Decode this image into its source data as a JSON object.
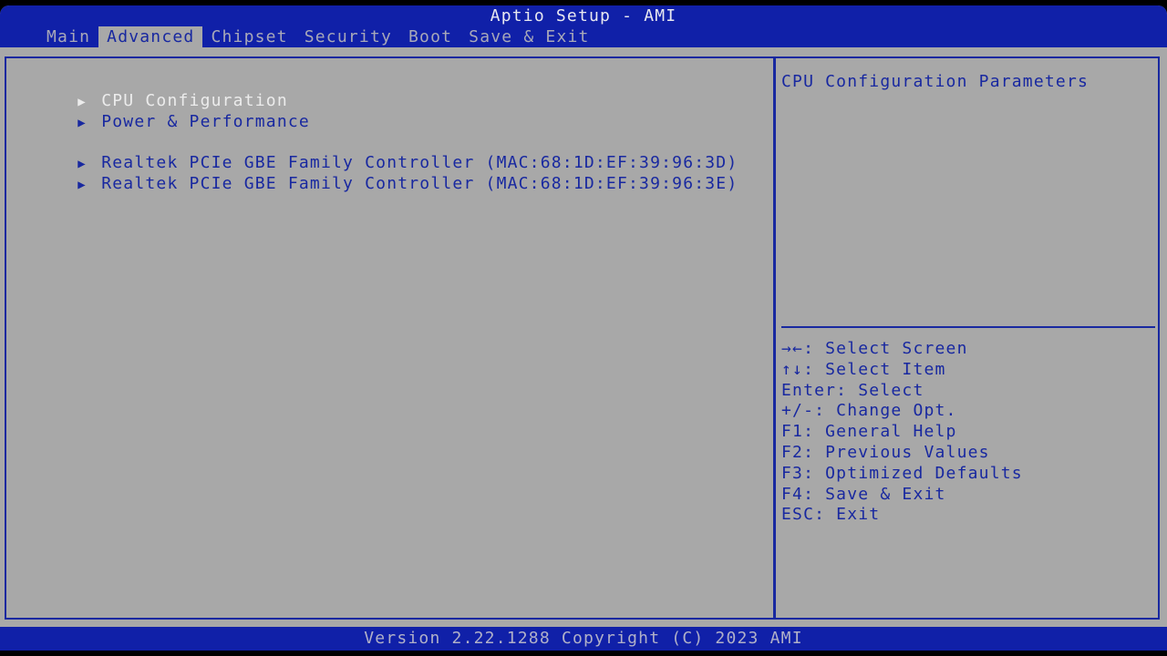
{
  "header": {
    "title": "Aptio Setup - AMI",
    "tabs": [
      {
        "label": "Main",
        "active": false
      },
      {
        "label": "Advanced",
        "active": true
      },
      {
        "label": "Chipset",
        "active": false
      },
      {
        "label": "Security",
        "active": false
      },
      {
        "label": "Boot",
        "active": false
      },
      {
        "label": "Save & Exit",
        "active": false
      }
    ]
  },
  "menu": {
    "arrow_icon": "▶",
    "items": [
      {
        "label": "CPU Configuration",
        "selected": true
      },
      {
        "label": "Power & Performance",
        "selected": false
      },
      {
        "label": "Realtek PCIe GBE Family Controller (MAC:68:1D:EF:39:96:3D)",
        "selected": false
      },
      {
        "label": "Realtek PCIe GBE Family Controller (MAC:68:1D:EF:39:96:3E)",
        "selected": false
      }
    ]
  },
  "help": {
    "description": "CPU Configuration Parameters",
    "keys": [
      "→←: Select Screen",
      "↑↓: Select Item",
      "Enter: Select",
      "+/-: Change Opt.",
      "F1: General Help",
      "F2: Previous Values",
      "F3: Optimized Defaults",
      "F4: Save & Exit",
      "ESC: Exit"
    ]
  },
  "footer": {
    "version": "Version 2.22.1288 Copyright (C) 2023 AMI"
  },
  "colors": {
    "header_bg": "#1020a8",
    "body_bg": "#a8a8a8",
    "text_blue": "#1828a0",
    "selected_text": "#ececec"
  }
}
